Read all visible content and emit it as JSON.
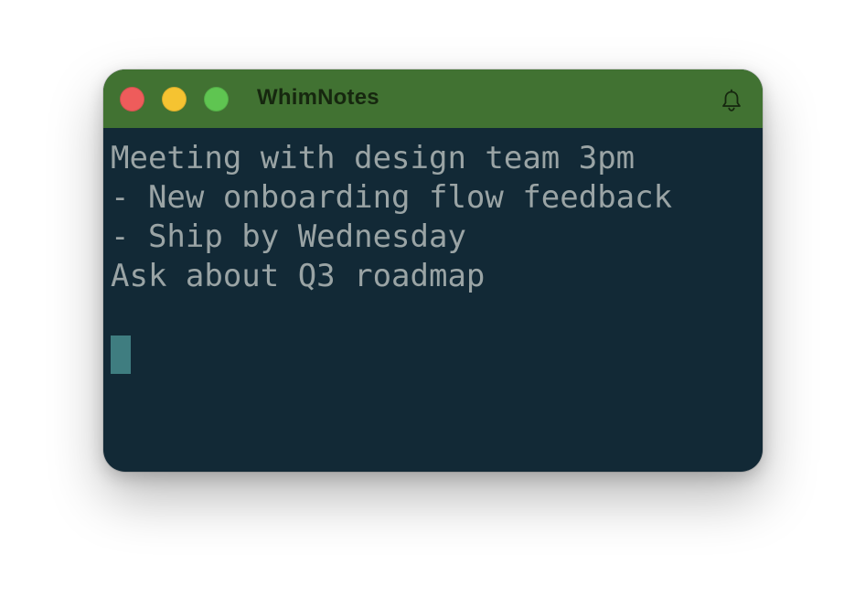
{
  "window": {
    "title": "WhimNotes",
    "colors": {
      "titlebar": "#417232",
      "editor_background": "#122936",
      "text": "#9aa4a5",
      "cursor": "#3f7d80",
      "close": "#ee5c5b",
      "minimize": "#f5c331",
      "maximize": "#5fc551"
    }
  },
  "toolbar": {
    "icons": [
      "bell-icon"
    ]
  },
  "editor": {
    "lines": [
      "Meeting with design team 3pm",
      "- New onboarding flow feedback",
      "- Ship by Wednesday",
      "Ask about Q3 roadmap",
      ""
    ]
  }
}
